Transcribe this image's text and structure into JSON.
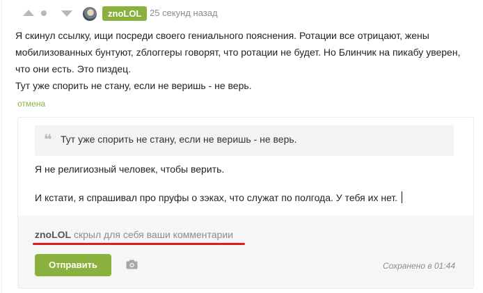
{
  "header": {
    "username": "znoLOL",
    "timestamp": "25 секунд назад",
    "vote_up_icon": "arrow-up-icon",
    "vote_down_icon": "arrow-down-icon",
    "rating_icon": "dot-icon"
  },
  "comment": {
    "lines": [
      "Я скинул ссылку, ищи посреди своего гениального пояснения. Ротации все отрицают, жены мобилизованных бунтуют, zблоггеры говорят, что ротации не будет. Но Блинчик на пикабу уверен, что они есть. Это пиздец.",
      "Тут уже спорить не стану, если не веришь - не верь."
    ],
    "cancel_label": "отмена"
  },
  "reply": {
    "quote_text": "Тут уже спорить не стану, если не веришь - не верь.",
    "line1": "Я не религиозный человек, чтобы верить.",
    "line2": "И кстати, я спрашивал про пруфы о зэках, что служат по полгода. У тебя их нет.",
    "hidden_user": "znoLOL",
    "hidden_text": "скрыл для себя ваши комментарии",
    "send_label": "Отправить",
    "saved_status": "Сохранено в 01:44",
    "camera_icon": "camera-icon",
    "accent_color": "#8ab13d",
    "highlight_color": "#e01b1b"
  }
}
